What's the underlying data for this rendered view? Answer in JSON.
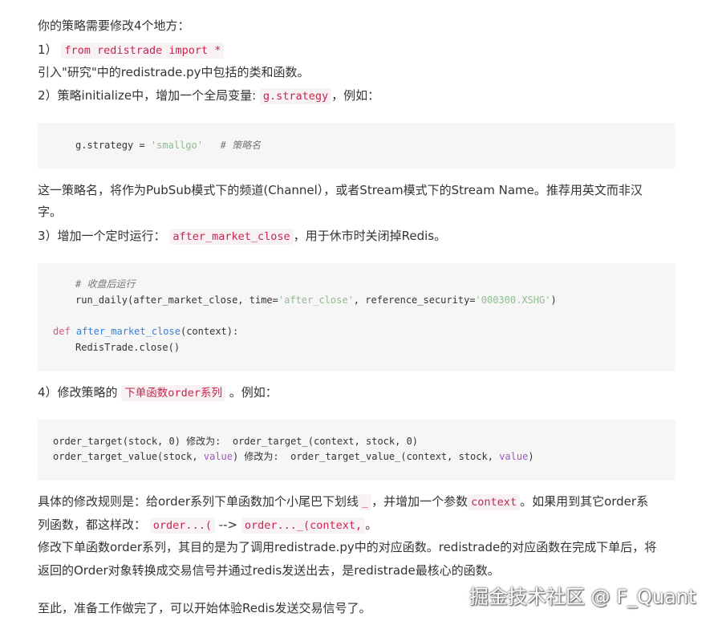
{
  "para1": {
    "text": "你的策略需要修改4个地方："
  },
  "step1": {
    "num": "1）",
    "code": "from redistrade import *"
  },
  "step1_desc": {
    "text": "引入\"研究\"中的redistrade.py中包括的类和函数。"
  },
  "step2": {
    "prefix": "2）策略initialize中，增加一个全局变量: ",
    "code": "g.strategy",
    "suffix": "，例如："
  },
  "code1": {
    "lhs": "g.strategy = ",
    "str": "'smallgo'",
    "comment": "# 策略名"
  },
  "para2": {
    "line1": "这一策略名，将作为PubSub模式下的频道(Channel），或者Stream模式下的Stream Name。推荐用英文而非汉",
    "line2": "字。"
  },
  "step3": {
    "prefix": "3）增加一个定时运行： ",
    "code": "after_market_close",
    "suffix": "，用于休市时关闭掉Redis。"
  },
  "code2": {
    "comment": "# 收盘后运行",
    "line2_a": "run_daily(after_market_close, time=",
    "line2_b": "'after_close'",
    "line2_c": ", reference_security=",
    "line2_d": "'000300.XSHG'",
    "line2_e": ")",
    "def_kw": "def",
    "def_fn": "after_market_close",
    "def_args": "(context):",
    "body": "RedisTrade.close()"
  },
  "step4": {
    "prefix": "4）修改策略的 ",
    "code": "下单函数order系列",
    "suffix": " 。例如："
  },
  "code3": {
    "l1": "order_target(stock, 0) 修改为:  order_target_(context, stock, 0)",
    "l2_a": "order_target_value(stock, ",
    "l2_b": "value",
    "l2_c": ") 修改为:  order_target_value_(context, stock, ",
    "l2_d": "value",
    "l2_e": ")"
  },
  "para3": {
    "a": "具体的修改规则是：给order系列下单函数加个小尾巴下划线",
    "b": "_",
    "c": "，并增加一个参数",
    "d": "context",
    "e": "。如果用到其它order系",
    "f": "列函数，都这样改：",
    "g": "order...(",
    "h": " --> ",
    "i": "order..._(context,",
    "j": "。"
  },
  "para4": {
    "line1": "修改下单函数order系列，其目的是为了调用redistrade.py中的对应函数。redistrade的对应函数在完成下单后，将",
    "line2": "返回的Order对象转换成交易信号并通过redis发送出去，是redistrade最核心的函数。"
  },
  "para5": {
    "text": "至此，准备工作做完了，可以开始体验Redis发送交易信号了。"
  },
  "watermark": {
    "text": "掘金技术社区 @ F_Quant"
  }
}
